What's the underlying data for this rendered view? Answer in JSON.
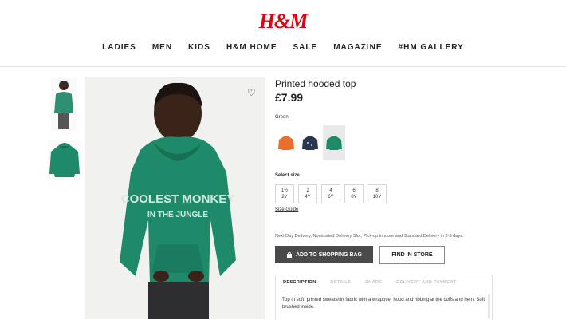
{
  "brand": {
    "logo_text": "H&M",
    "color": "#e50010"
  },
  "nav": [
    "LADIES",
    "MEN",
    "KIDS",
    "H&M HOME",
    "SALE",
    "MAGAZINE",
    "#HM GALLERY"
  ],
  "product": {
    "name": "Printed hooded top",
    "price": "£7.99",
    "print_text_line1": "COOLEST MONKEY",
    "print_text_line2": "IN THE JUNGLE"
  },
  "color_label": "Green",
  "colors": [
    {
      "name": "orange",
      "hex": "#e8702c"
    },
    {
      "name": "navy",
      "hex": "#2a3550"
    },
    {
      "name": "green",
      "hex": "#1f8a6a",
      "selected": true
    }
  ],
  "size_label": "Select size",
  "sizes": [
    [
      "1½",
      "2Y"
    ],
    [
      "2",
      "4Y"
    ],
    [
      "4",
      "6Y"
    ],
    [
      "6",
      "8Y"
    ],
    [
      "8",
      "10Y"
    ]
  ],
  "size_guide": "Size Guide",
  "delivery_text": "Next Day Delivery, Nominated Delivery Slot, Pick-up in store and Standard Delivery in 2-3 days.",
  "buttons": {
    "add_to_bag": "ADD TO SHOPPING BAG",
    "find_in_store": "FIND IN STORE"
  },
  "tabs": [
    "DESCRIPTION",
    "DETAILS",
    "SHARE",
    "DELIVERY AND PAYMENT"
  ],
  "description": "Top in soft, printed sweatshirt fabric with a wrapover hood and ribbing at the cuffs and hem. Soft brushed inside."
}
